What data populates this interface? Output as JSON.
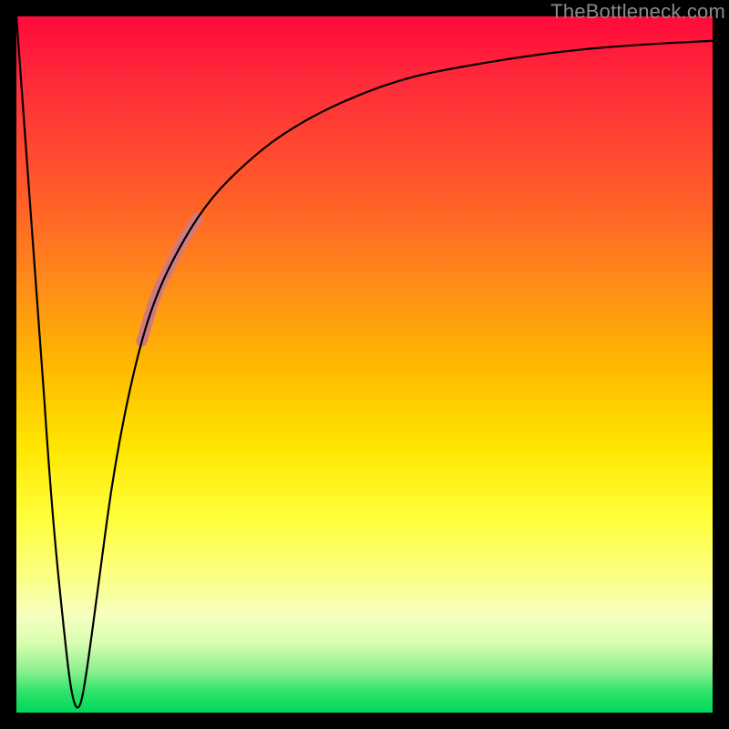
{
  "watermark": "TheBottleneck.com",
  "colors": {
    "frame": "#000000",
    "curve": "#000000",
    "highlight": "#cf7b7d",
    "gradient_top": "#ff0a3a",
    "gradient_bottom": "#00d85a"
  },
  "chart_data": {
    "type": "line",
    "title": "",
    "xlabel": "",
    "ylabel": "",
    "xlim": [
      0,
      100
    ],
    "ylim": [
      0,
      100
    ],
    "grid": false,
    "legend": false,
    "annotations": [
      {
        "type": "highlight_segment",
        "x_range": [
          18,
          26
        ],
        "note": "thick pink overlay on curve"
      }
    ],
    "series": [
      {
        "name": "bottleneck-curve",
        "x": [
          0,
          3,
          5,
          7,
          8,
          9,
          10,
          12,
          14,
          17,
          20,
          24,
          28,
          33,
          38,
          45,
          55,
          65,
          78,
          90,
          100
        ],
        "y": [
          100,
          60,
          30,
          10,
          2,
          0,
          5,
          20,
          35,
          50,
          60,
          68,
          74,
          79,
          83,
          87,
          91,
          93,
          95,
          96,
          96.5
        ]
      }
    ]
  }
}
